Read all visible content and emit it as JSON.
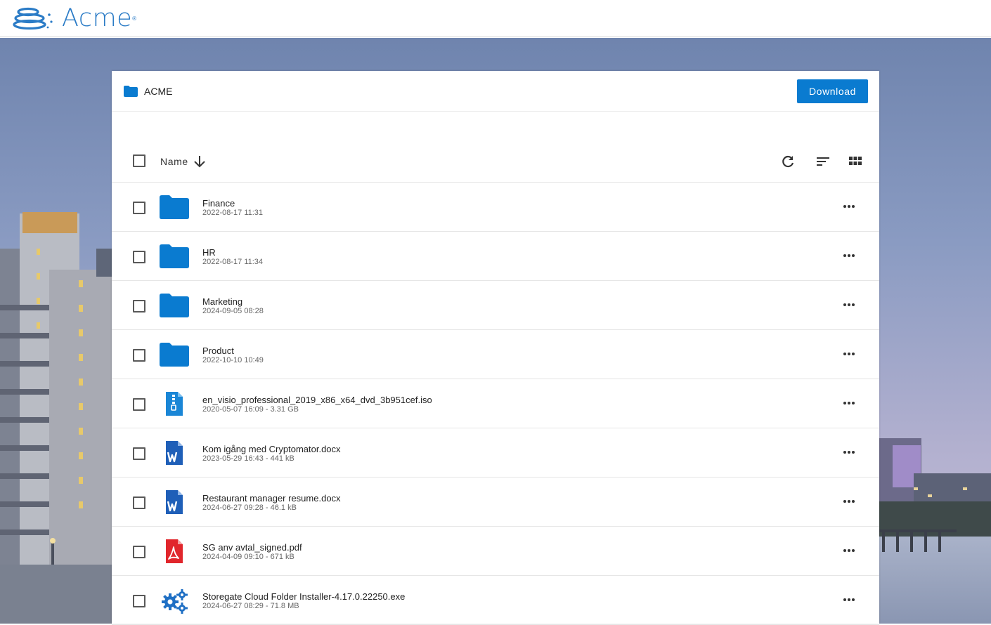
{
  "brand": {
    "name": "Acme",
    "mark": "®",
    "color": "#2a7bc6"
  },
  "panel": {
    "breadcrumb": {
      "icon": "folder-icon",
      "label": "ACME"
    },
    "download_label": "Download",
    "toolbar": {
      "sort_label": "Name",
      "sort_direction_icon": "arrow-down-icon",
      "refresh_icon": "refresh-icon",
      "sort_icon": "sort-lines-icon",
      "view_icon": "grid-view-icon"
    }
  },
  "items": [
    {
      "name": "Finance",
      "meta": "2022-08-17 11:31",
      "type": "folder"
    },
    {
      "name": "HR",
      "meta": "2022-08-17 11:34",
      "type": "folder"
    },
    {
      "name": "Marketing",
      "meta": "2024-09-05 08:28",
      "type": "folder"
    },
    {
      "name": "Product",
      "meta": "2022-10-10 10:49",
      "type": "folder"
    },
    {
      "name": "en_visio_professional_2019_x86_x64_dvd_3b951cef.iso",
      "meta": "2020-05-07 16:09 - 3.31 GB",
      "type": "archive"
    },
    {
      "name": "Kom igång med Cryptomator.docx",
      "meta": "2023-05-29 16:43 - 441 kB",
      "type": "word"
    },
    {
      "name": "Restaurant manager resume.docx",
      "meta": "2024-06-27 09:28 - 46.1 kB",
      "type": "word"
    },
    {
      "name": "SG anv avtal_signed.pdf",
      "meta": "2024-04-09 09:10 - 671 kB",
      "type": "pdf"
    },
    {
      "name": "Storegate Cloud Folder Installer-4.17.0.22250.exe",
      "meta": "2024-06-27 08:29 - 71.8 MB",
      "type": "exe"
    }
  ],
  "colors": {
    "accent": "#0a7bd0",
    "folder": "#0a7bd0",
    "pdf": "#e1262c",
    "word": "#1f5fb8"
  }
}
